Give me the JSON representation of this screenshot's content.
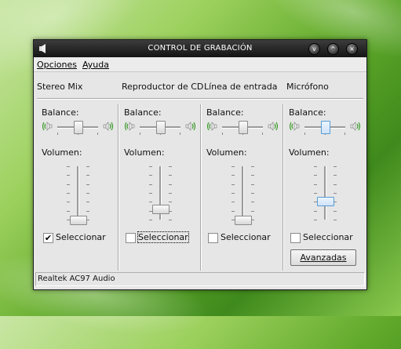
{
  "window": {
    "title": "CONTROL DE GRABACIÓN",
    "buttons": {
      "minimize": "v",
      "maximize": "^",
      "close": "×"
    }
  },
  "menu": {
    "items": [
      "Opciones",
      "Ayuda"
    ]
  },
  "channels": [
    {
      "name": "Stereo Mix",
      "balance_label": "Balance:",
      "volume_label": "Volumen:",
      "balance_pos": 0.5,
      "volume_level": 0.0,
      "select_label": "Seleccionar",
      "selected": true
    },
    {
      "name": "Reproductor de CD",
      "balance_label": "Balance:",
      "volume_label": "Volumen:",
      "balance_pos": 0.5,
      "volume_level": 0.2,
      "select_label": "Seleccionar",
      "selected": false
    },
    {
      "name": "Línea de entrada",
      "balance_label": "Balance:",
      "volume_label": "Volumen:",
      "balance_pos": 0.5,
      "volume_level": 0.0,
      "select_label": "Seleccionar",
      "selected": false
    },
    {
      "name": "Micrófono",
      "balance_label": "Balance:",
      "volume_label": "Volumen:",
      "balance_pos": 0.5,
      "volume_level": 0.35,
      "select_label": "Seleccionar",
      "selected": false
    }
  ],
  "advanced_button": "Avanzadas",
  "status_bar": "Realtek AC97 Audio",
  "colors": {
    "accent": "#5a9bd4",
    "speaker_wave": "#3a9a2a"
  }
}
